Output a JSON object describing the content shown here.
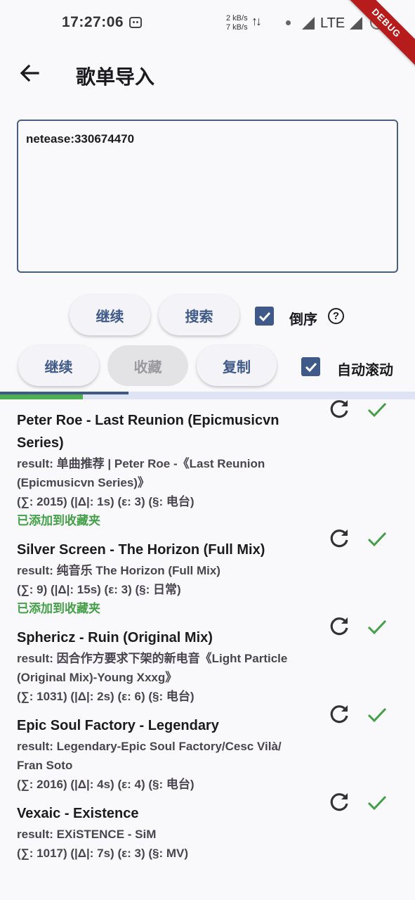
{
  "status_bar": {
    "time": "17:27:06",
    "upload_speed": "2 kB/s",
    "download_speed": "7 kB/s",
    "network": "LTE",
    "debug_label": "DEBUG"
  },
  "app_bar": {
    "title": "歌单导入"
  },
  "playlist_input": {
    "value": "netease:330674470"
  },
  "row1": {
    "continue_label": "继续",
    "search_label": "搜索",
    "reverse_label": "倒序",
    "reverse_checked": true,
    "help_icon": "?"
  },
  "row2": {
    "continue_label": "继续",
    "favorite_label": "收藏",
    "copy_label": "复制",
    "autoscroll_label": "自动滚动",
    "autoscroll_checked": true
  },
  "progress": {
    "primary_fraction": 0.31,
    "secondary_fraction": 0.2
  },
  "colors": {
    "primary": "#3f5a88",
    "success": "#43a047",
    "debug": "#b71c1c"
  },
  "songs": [
    {
      "title": "Peter Roe - Last Reunion (Epicmusicvn Series)",
      "result": "result: 单曲推荐 | Peter Roe -《Last Reunion (Epicmusicvn Series)》",
      "stats": "(∑: 2015) (|Δ|: 1s) (ε: 3) (§: 电台)",
      "added": "已添加到收藏夹"
    },
    {
      "title": "Silver Screen - The Horizon (Full Mix)",
      "result": "result: 纯音乐  The Horizon (Full Mix)",
      "stats": "(∑: 9) (|Δ|: 15s) (ε: 3) (§: 日常)",
      "added": "已添加到收藏夹"
    },
    {
      "title": "Sphericz - Ruin (Original Mix)",
      "result": "result: 因合作方要求下架的新电音《Light Particle (Original Mix)-Young Xxxg》",
      "stats": "(∑: 1031) (|Δ|: 2s) (ε: 6) (§: 电台)",
      "added": ""
    },
    {
      "title": "Epic Soul Factory - Legendary",
      "result": "result: Legendary-Epic Soul Factory/Cesc Vilà/ Fran Soto",
      "stats": "(∑: 2016) (|Δ|: 4s) (ε: 4) (§: 电台)",
      "added": ""
    },
    {
      "title": "Vexaic - Existence",
      "result": "result: EXiSTENCE - SiM",
      "stats": "(∑: 1017) (|Δ|: 7s) (ε: 3) (§: MV)",
      "added": ""
    }
  ]
}
